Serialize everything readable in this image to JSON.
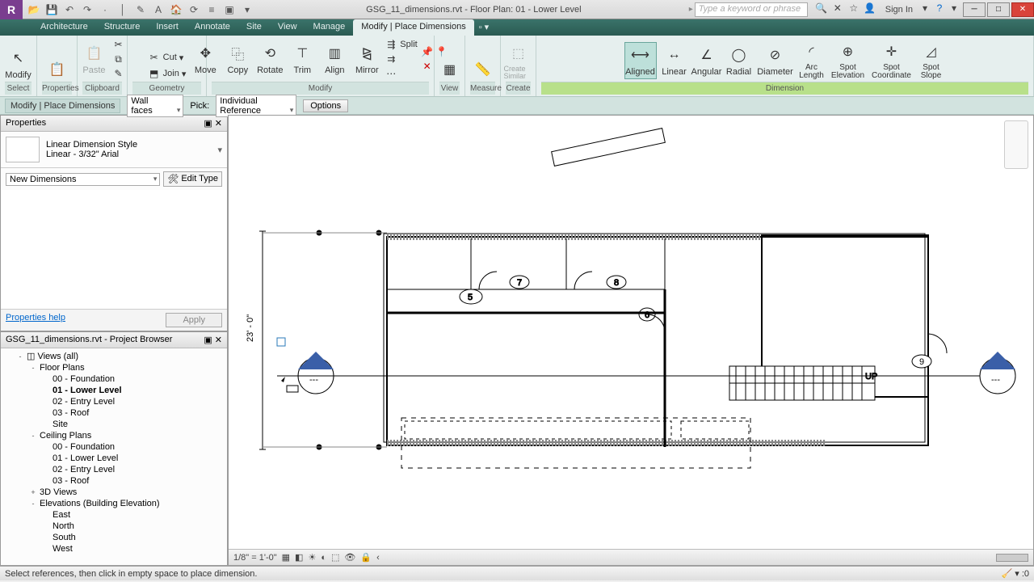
{
  "titlebar": {
    "title": "GSG_11_dimensions.rvt - Floor Plan: 01 - Lower Level",
    "search_placeholder": "Type a keyword or phrase",
    "signin": "Sign In"
  },
  "tabs": [
    "Architecture",
    "Structure",
    "Insert",
    "Annotate",
    "Site",
    "View",
    "Manage",
    "Modify | Place Dimensions"
  ],
  "active_tab": 7,
  "ribbon": {
    "select": "Select",
    "properties": "Properties",
    "clipboard": "Clipboard",
    "geometry": "Geometry",
    "modify_group": "Modify",
    "view": "View",
    "measure": "Measure",
    "create": "Create",
    "dimension": "Dimension",
    "modify_btn": "Modify",
    "paste": "Paste",
    "cut": "Cut",
    "join": "Join",
    "move": "Move",
    "copy": "Copy",
    "rotate": "Rotate",
    "trim": "Trim",
    "align": "Align",
    "mirror": "Mirror",
    "split": "Split",
    "create_similar": "Create Similar",
    "aligned": "Aligned",
    "linear": "Linear",
    "angular": "Angular",
    "radial": "Radial",
    "diameter": "Diameter",
    "arc_length": "Arc Length",
    "spot_elevation": "Spot Elevation",
    "spot_coordinate": "Spot Coordinate",
    "spot_slope": "Spot Slope"
  },
  "optionsbar": {
    "context": "Modify | Place Dimensions",
    "select1": "Wall faces",
    "pick_label": "Pick:",
    "select2": "Individual Reference",
    "options_btn": "Options"
  },
  "properties": {
    "title": "Properties",
    "type_name": "Linear Dimension Style",
    "type_value": "Linear - 3/32\" Arial",
    "category": "New Dimensions",
    "edit_type": "Edit Type",
    "help": "Properties help",
    "apply": "Apply"
  },
  "browser": {
    "title": "GSG_11_dimensions.rvt - Project Browser",
    "items": [
      {
        "level": 0,
        "toggle": "-",
        "label": "Views (all)",
        "icon": "◫"
      },
      {
        "level": 1,
        "toggle": "-",
        "label": "Floor Plans"
      },
      {
        "level": 2,
        "label": "00 - Foundation"
      },
      {
        "level": 2,
        "label": "01 - Lower Level",
        "bold": true
      },
      {
        "level": 2,
        "label": "02 - Entry Level"
      },
      {
        "level": 2,
        "label": "03 - Roof"
      },
      {
        "level": 2,
        "label": "Site"
      },
      {
        "level": 1,
        "toggle": "-",
        "label": "Ceiling Plans"
      },
      {
        "level": 2,
        "label": "00 - Foundation"
      },
      {
        "level": 2,
        "label": "01 - Lower Level"
      },
      {
        "level": 2,
        "label": "02 - Entry Level"
      },
      {
        "level": 2,
        "label": "03 - Roof"
      },
      {
        "level": 1,
        "toggle": "+",
        "label": "3D Views"
      },
      {
        "level": 1,
        "toggle": "-",
        "label": "Elevations (Building Elevation)"
      },
      {
        "level": 2,
        "label": "East"
      },
      {
        "level": 2,
        "label": "North"
      },
      {
        "level": 2,
        "label": "South"
      },
      {
        "level": 2,
        "label": "West"
      }
    ]
  },
  "viewbar": {
    "scale": "1/8\" = 1'-0\""
  },
  "canvas": {
    "dim_text": "23' - 0\"",
    "tags": [
      "5",
      "6",
      "7",
      "8",
      "9"
    ],
    "up": "UP"
  },
  "status": "Select references, then click in empty space to place dimension."
}
